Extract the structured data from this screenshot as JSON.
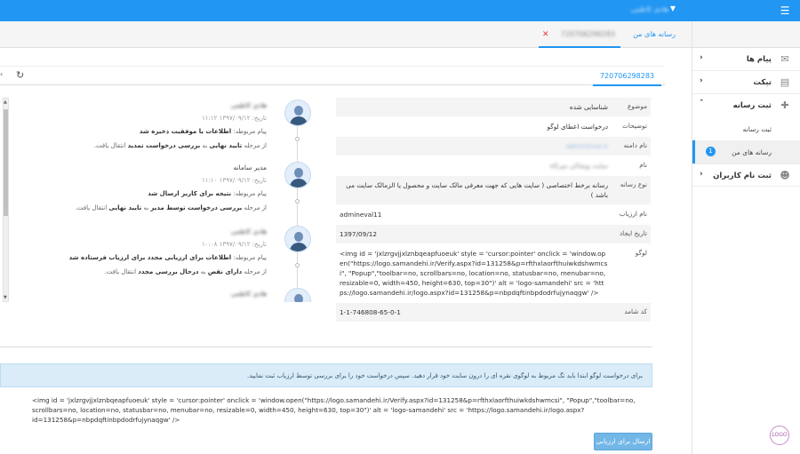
{
  "topbar": {
    "username": "هادی کاظمی"
  },
  "tabs": {
    "home": "رسانه های من",
    "doc": "720706298283"
  },
  "toolbar": {
    "doc_id": "720706298283"
  },
  "sidebar": {
    "items": [
      {
        "label": "پیام ها",
        "icon": "mail-icon"
      },
      {
        "label": "تیکت",
        "icon": "chat-icon"
      },
      {
        "label": "ثبت رسانه",
        "icon": "document-add-icon"
      },
      {
        "label": "ثبت نام کاربران",
        "icon": "person-add-icon"
      }
    ],
    "subitems": [
      {
        "label": "ثبت رسانه"
      },
      {
        "label": "رسانه های من",
        "badge": "1"
      }
    ],
    "logo_text": "LOGO"
  },
  "details": {
    "rows": [
      {
        "key": "موضوع",
        "value": "شناسایی شده"
      },
      {
        "key": "توضیحات",
        "value": "درخواست اعطای لوگو"
      },
      {
        "key": "نام دامنه",
        "value": "adminlevel.ir"
      },
      {
        "key": "نام",
        "value": "سایت پوشاکی میرکاه"
      },
      {
        "key": "نوع رسانه",
        "value": "رسانه برخط اختصاصی ( سایت هایی که جهت معرفی مالک سایت و محصول یا الزمالک سایت می باشد )"
      },
      {
        "key": "نام ارزیاب",
        "value": "admineval11"
      },
      {
        "key": "تاریخ ایجاد",
        "value": "1397/09/12"
      },
      {
        "key": "لوگو",
        "value": "<img id = 'jxlzrgvjjxlznbqeapfuoeuk' style = 'cursor:pointer' onclick = 'window.open(\"https://logo.samandehi.ir/Verify.aspx?id=131258&p=rfthxlaorfthuiwkdshwmcsi\", \"Popup\",\"toolbar=no, scrollbars=no, location=no, statusbar=no, menubar=no, resizable=0, width=450, height=630, top=30\")' alt = 'logo-samandehi' src = 'https://logo.samandehi.ir/logo.aspx?id=131258&p=nbpdqftinbpdodrfujynaqgw' />"
      },
      {
        "key": "کد شامد",
        "value": "1-1-746808-65-0-1"
      }
    ]
  },
  "timeline": [
    {
      "who": "هادی کاظمی",
      "date_label": "تاریخ:",
      "date": "۱۳۹۷/۰۹/۱۲  ۱۱:۱۲",
      "msg_label": "پیام مربوطه:",
      "msg": "اطلاعات با موفقیت ذخیره شد",
      "transition_pre": "از مرحله",
      "from_stage": "تایید نهایی",
      "transition_mid": "به",
      "to_stage": "بررسی درخواست تمدید",
      "transition_post": "انتقال یافت."
    },
    {
      "who": "مدیر سامانه",
      "date_label": "تاریخ:",
      "date": "۱۳۹۷/۰۹/۱۲  ۱۱:۱۰",
      "msg_label": "پیام مربوطه:",
      "msg": "نتیجه برای کاربر ارسال شد",
      "transition_pre": "از مرحله",
      "from_stage": "بررسی درخواست توسط مدیر",
      "transition_mid": "به",
      "to_stage": "تایید نهایی",
      "transition_post": "انتقال یافت."
    },
    {
      "who": "هادی کاظمی",
      "date_label": "تاریخ:",
      "date": "۱۳۹۷/۰۹/۱۲  ۱۰:۰۸",
      "msg_label": "پیام مربوطه:",
      "msg": "اطلاعات برای ارزیابی مجدد برای ارزیاب فرستاده شد",
      "transition_pre": "از مرحله",
      "from_stage": "دارای نقص",
      "transition_mid": "به",
      "to_stage": "درحال بررسی مجدد",
      "transition_post": "انتقال یافت."
    },
    {
      "who": "هادی کاظمی"
    }
  ],
  "notice": "برای درخواست لوگو ابتدا باید تگ مربوط به لوگوی نقره ای را درون سایت خود قرار دهید. سپس درخواست خود را برای بررسی توسط ارزیاب ثبت نمایید.",
  "code_snippet": "<img id = 'jxlzrgvjjxlznbqeapfuoeuk' style = 'cursor:pointer' onclick = 'window.open(\"https://logo.samandehi.ir/Verify.aspx?id=131258&p=rfthxlaorfthuiwkdshwmcsi\", \"Popup\",\"toolbar=no, scrollbars=no, location=no, statusbar=no, menubar=no, resizable=0, width=450, height=630, top=30\")' alt = 'logo-samandehi' src = 'https://logo.samandehi.ir/logo.aspx?id=131258&p=nbpdqftinbpdodrfujynaqgw' />",
  "submit_label": "ارسال برای ارزیابی",
  "colors": {
    "primary": "#2196f3",
    "notice_bg": "#d9ecf8",
    "button": "#73b7e6",
    "close": "#e53935"
  }
}
